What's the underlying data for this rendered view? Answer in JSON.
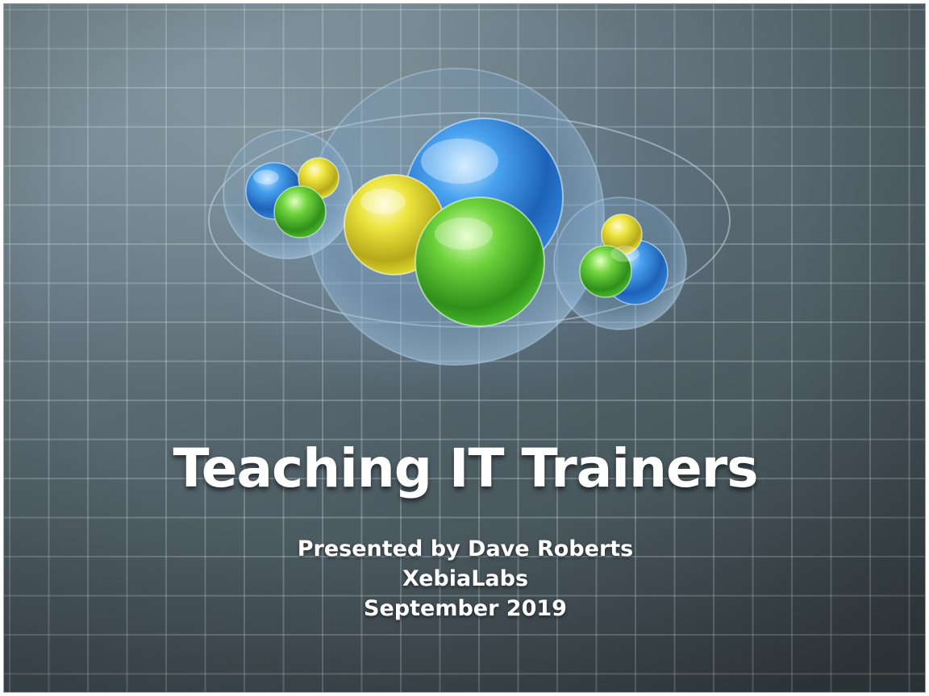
{
  "slide": {
    "title": "Teaching IT Trainers",
    "subtitle_lines": [
      "Presented by Dave Roberts",
      "XebiaLabs",
      "September 2019"
    ]
  },
  "theme": {
    "background": "#5a6a72",
    "grid_line": "#d2e1e6",
    "text": "#ffffff",
    "sphere_colors": {
      "blue": "#2f7fd6",
      "yellow": "#d9d62a",
      "green": "#47b52a"
    }
  },
  "decoration": {
    "icon": "glass-spheres-icon"
  }
}
